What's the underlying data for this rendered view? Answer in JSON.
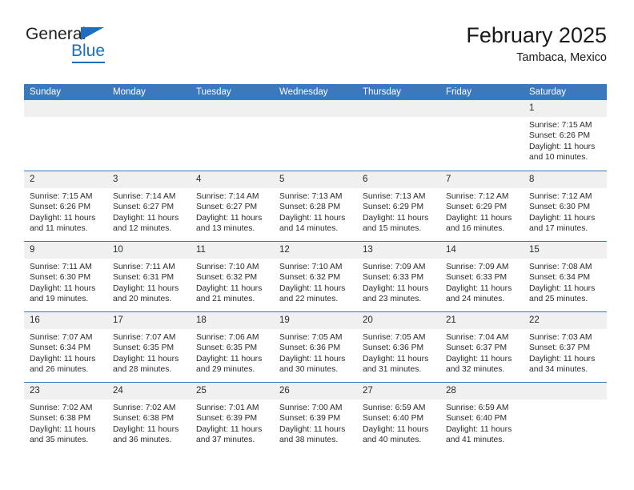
{
  "brand": {
    "name_top": "General",
    "name_bottom": "Blue",
    "logo_icon": "triangle-icon",
    "accent_color": "#1b6ec2"
  },
  "header": {
    "title": "February 2025",
    "subtitle": "Tambaca, Mexico"
  },
  "calendar": {
    "header_color": "#3a79bd",
    "daynumber_band_color": "#f0f0f0",
    "weekdays": [
      "Sunday",
      "Monday",
      "Tuesday",
      "Wednesday",
      "Thursday",
      "Friday",
      "Saturday"
    ],
    "weeks": [
      [
        {
          "day": "",
          "sunrise": "",
          "sunset": "",
          "daylight": "",
          "empty": true
        },
        {
          "day": "",
          "sunrise": "",
          "sunset": "",
          "daylight": "",
          "empty": true
        },
        {
          "day": "",
          "sunrise": "",
          "sunset": "",
          "daylight": "",
          "empty": true
        },
        {
          "day": "",
          "sunrise": "",
          "sunset": "",
          "daylight": "",
          "empty": true
        },
        {
          "day": "",
          "sunrise": "",
          "sunset": "",
          "daylight": "",
          "empty": true
        },
        {
          "day": "",
          "sunrise": "",
          "sunset": "",
          "daylight": "",
          "empty": true
        },
        {
          "day": "1",
          "sunrise": "Sunrise: 7:15 AM",
          "sunset": "Sunset: 6:26 PM",
          "daylight": "Daylight: 11 hours and 10 minutes.",
          "empty": false
        }
      ],
      [
        {
          "day": "2",
          "sunrise": "Sunrise: 7:15 AM",
          "sunset": "Sunset: 6:26 PM",
          "daylight": "Daylight: 11 hours and 11 minutes.",
          "empty": false
        },
        {
          "day": "3",
          "sunrise": "Sunrise: 7:14 AM",
          "sunset": "Sunset: 6:27 PM",
          "daylight": "Daylight: 11 hours and 12 minutes.",
          "empty": false
        },
        {
          "day": "4",
          "sunrise": "Sunrise: 7:14 AM",
          "sunset": "Sunset: 6:27 PM",
          "daylight": "Daylight: 11 hours and 13 minutes.",
          "empty": false
        },
        {
          "day": "5",
          "sunrise": "Sunrise: 7:13 AM",
          "sunset": "Sunset: 6:28 PM",
          "daylight": "Daylight: 11 hours and 14 minutes.",
          "empty": false
        },
        {
          "day": "6",
          "sunrise": "Sunrise: 7:13 AM",
          "sunset": "Sunset: 6:29 PM",
          "daylight": "Daylight: 11 hours and 15 minutes.",
          "empty": false
        },
        {
          "day": "7",
          "sunrise": "Sunrise: 7:12 AM",
          "sunset": "Sunset: 6:29 PM",
          "daylight": "Daylight: 11 hours and 16 minutes.",
          "empty": false
        },
        {
          "day": "8",
          "sunrise": "Sunrise: 7:12 AM",
          "sunset": "Sunset: 6:30 PM",
          "daylight": "Daylight: 11 hours and 17 minutes.",
          "empty": false
        }
      ],
      [
        {
          "day": "9",
          "sunrise": "Sunrise: 7:11 AM",
          "sunset": "Sunset: 6:30 PM",
          "daylight": "Daylight: 11 hours and 19 minutes.",
          "empty": false
        },
        {
          "day": "10",
          "sunrise": "Sunrise: 7:11 AM",
          "sunset": "Sunset: 6:31 PM",
          "daylight": "Daylight: 11 hours and 20 minutes.",
          "empty": false
        },
        {
          "day": "11",
          "sunrise": "Sunrise: 7:10 AM",
          "sunset": "Sunset: 6:32 PM",
          "daylight": "Daylight: 11 hours and 21 minutes.",
          "empty": false
        },
        {
          "day": "12",
          "sunrise": "Sunrise: 7:10 AM",
          "sunset": "Sunset: 6:32 PM",
          "daylight": "Daylight: 11 hours and 22 minutes.",
          "empty": false
        },
        {
          "day": "13",
          "sunrise": "Sunrise: 7:09 AM",
          "sunset": "Sunset: 6:33 PM",
          "daylight": "Daylight: 11 hours and 23 minutes.",
          "empty": false
        },
        {
          "day": "14",
          "sunrise": "Sunrise: 7:09 AM",
          "sunset": "Sunset: 6:33 PM",
          "daylight": "Daylight: 11 hours and 24 minutes.",
          "empty": false
        },
        {
          "day": "15",
          "sunrise": "Sunrise: 7:08 AM",
          "sunset": "Sunset: 6:34 PM",
          "daylight": "Daylight: 11 hours and 25 minutes.",
          "empty": false
        }
      ],
      [
        {
          "day": "16",
          "sunrise": "Sunrise: 7:07 AM",
          "sunset": "Sunset: 6:34 PM",
          "daylight": "Daylight: 11 hours and 26 minutes.",
          "empty": false
        },
        {
          "day": "17",
          "sunrise": "Sunrise: 7:07 AM",
          "sunset": "Sunset: 6:35 PM",
          "daylight": "Daylight: 11 hours and 28 minutes.",
          "empty": false
        },
        {
          "day": "18",
          "sunrise": "Sunrise: 7:06 AM",
          "sunset": "Sunset: 6:35 PM",
          "daylight": "Daylight: 11 hours and 29 minutes.",
          "empty": false
        },
        {
          "day": "19",
          "sunrise": "Sunrise: 7:05 AM",
          "sunset": "Sunset: 6:36 PM",
          "daylight": "Daylight: 11 hours and 30 minutes.",
          "empty": false
        },
        {
          "day": "20",
          "sunrise": "Sunrise: 7:05 AM",
          "sunset": "Sunset: 6:36 PM",
          "daylight": "Daylight: 11 hours and 31 minutes.",
          "empty": false
        },
        {
          "day": "21",
          "sunrise": "Sunrise: 7:04 AM",
          "sunset": "Sunset: 6:37 PM",
          "daylight": "Daylight: 11 hours and 32 minutes.",
          "empty": false
        },
        {
          "day": "22",
          "sunrise": "Sunrise: 7:03 AM",
          "sunset": "Sunset: 6:37 PM",
          "daylight": "Daylight: 11 hours and 34 minutes.",
          "empty": false
        }
      ],
      [
        {
          "day": "23",
          "sunrise": "Sunrise: 7:02 AM",
          "sunset": "Sunset: 6:38 PM",
          "daylight": "Daylight: 11 hours and 35 minutes.",
          "empty": false
        },
        {
          "day": "24",
          "sunrise": "Sunrise: 7:02 AM",
          "sunset": "Sunset: 6:38 PM",
          "daylight": "Daylight: 11 hours and 36 minutes.",
          "empty": false
        },
        {
          "day": "25",
          "sunrise": "Sunrise: 7:01 AM",
          "sunset": "Sunset: 6:39 PM",
          "daylight": "Daylight: 11 hours and 37 minutes.",
          "empty": false
        },
        {
          "day": "26",
          "sunrise": "Sunrise: 7:00 AM",
          "sunset": "Sunset: 6:39 PM",
          "daylight": "Daylight: 11 hours and 38 minutes.",
          "empty": false
        },
        {
          "day": "27",
          "sunrise": "Sunrise: 6:59 AM",
          "sunset": "Sunset: 6:40 PM",
          "daylight": "Daylight: 11 hours and 40 minutes.",
          "empty": false
        },
        {
          "day": "28",
          "sunrise": "Sunrise: 6:59 AM",
          "sunset": "Sunset: 6:40 PM",
          "daylight": "Daylight: 11 hours and 41 minutes.",
          "empty": false
        },
        {
          "day": "",
          "sunrise": "",
          "sunset": "",
          "daylight": "",
          "empty": true
        }
      ]
    ]
  }
}
